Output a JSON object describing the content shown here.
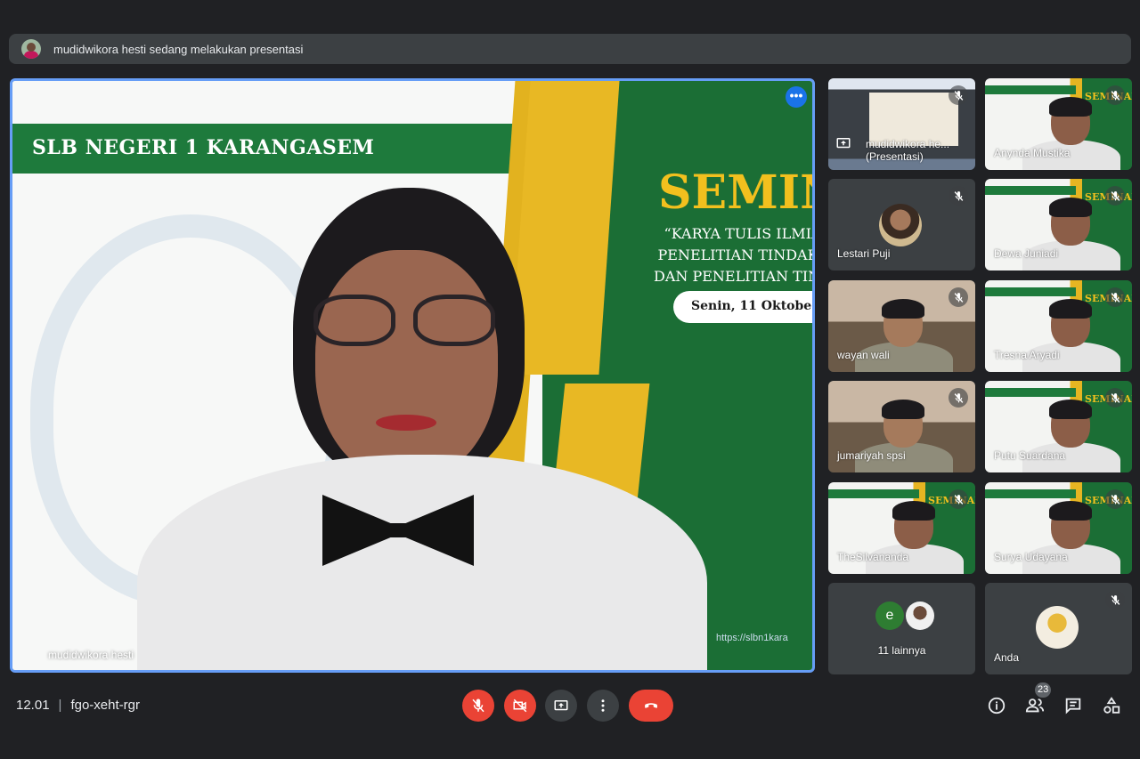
{
  "banner": {
    "text": "mudidwikora hesti sedang melakukan presentasi"
  },
  "main": {
    "presenter_name": "mudidwikora hesti",
    "slide": {
      "school": "SLB NEGERI 1 KARANGASEM",
      "heading": "SEMIN",
      "line1": "“KARYA TULIS ILMIA",
      "line2": "PENELITIAN TINDAKA",
      "line3": "DAN PENELITIAN TIND",
      "date": "Senin, 11 Oktobe",
      "url": "https://slbn1kara"
    },
    "more_label": "•••"
  },
  "tiles": [
    {
      "name": "mudidwikora he...\n(Presentasi)",
      "kind": "screen"
    },
    {
      "name": "Anynda Mustika",
      "kind": "slide"
    },
    {
      "name": "Lestari Puji",
      "kind": "avatar"
    },
    {
      "name": "Dewa Juniadi",
      "kind": "slide"
    },
    {
      "name": "wayan wali",
      "kind": "camera"
    },
    {
      "name": "Tresna Aryadi",
      "kind": "slide"
    },
    {
      "name": "jumariyah spsi",
      "kind": "camera"
    },
    {
      "name": "Putu Suardana",
      "kind": "slide"
    },
    {
      "name": "TheSilvananda",
      "kind": "slide"
    },
    {
      "name": "Surya Udayana",
      "kind": "slide"
    },
    {
      "name": "11 lainnya",
      "kind": "others",
      "initial": "e"
    },
    {
      "name": "Anda",
      "kind": "self"
    }
  ],
  "bottom": {
    "time": "12.01",
    "separator": "|",
    "meeting_code": "fgo-xeht-rgr",
    "participant_count": "23"
  },
  "colors": {
    "end_call": "#ea4335",
    "accent": "#669df6",
    "bg": "#202124"
  }
}
